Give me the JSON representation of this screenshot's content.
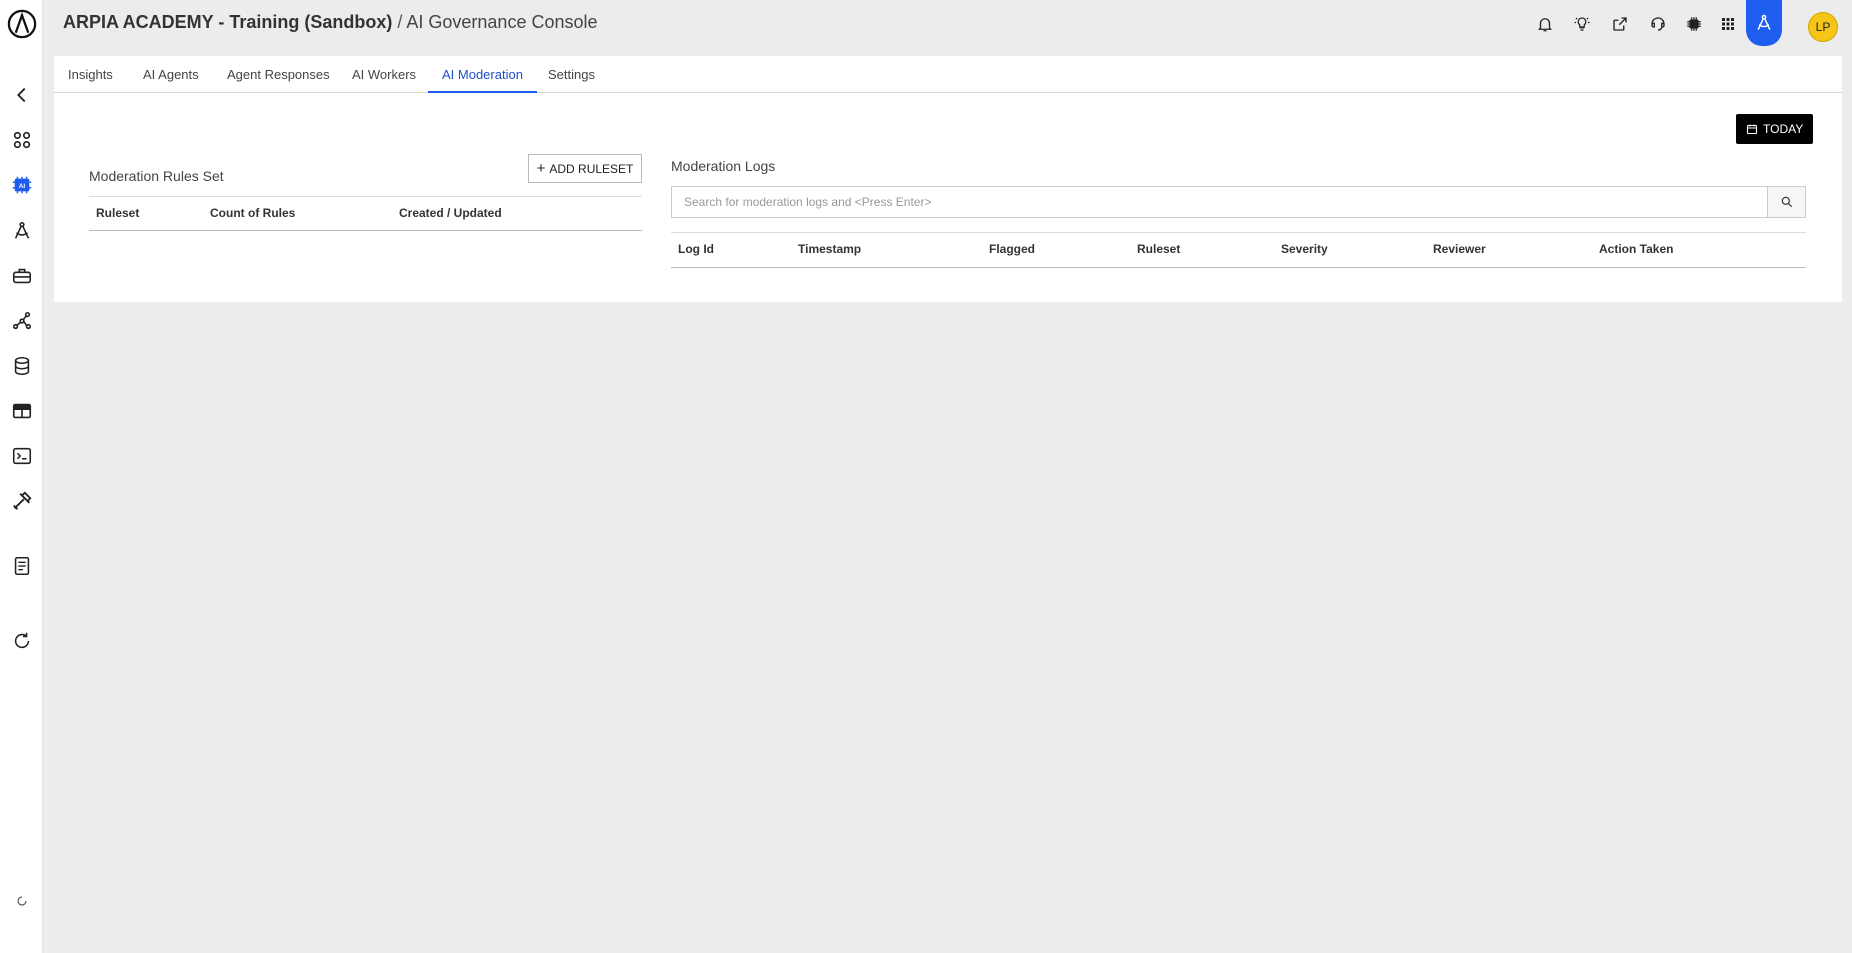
{
  "header": {
    "org_title": "ARPIA ACADEMY - Training (Sandbox)",
    "separator": "/",
    "page_title": "AI Governance Console",
    "avatar_initials": "LP",
    "accent_color": "#1f5cf0"
  },
  "sidebar": {
    "items": [
      {
        "icon": "arpia-logo-icon"
      },
      {
        "icon": "back-arrow-icon"
      },
      {
        "icon": "apps-grid-icon"
      },
      {
        "icon": "ai-chip-icon"
      },
      {
        "icon": "compass-draw-icon"
      },
      {
        "icon": "toolbox-icon"
      },
      {
        "icon": "graph-nodes-icon"
      },
      {
        "icon": "database-icon"
      },
      {
        "icon": "table-icon"
      },
      {
        "icon": "terminal-icon"
      },
      {
        "icon": "tools-icon"
      },
      {
        "icon": "notebook-icon"
      },
      {
        "icon": "refresh-icon"
      },
      {
        "icon": "loading-spinner-icon"
      }
    ]
  },
  "topbar_icons": [
    "bell-icon",
    "lightbulb-icon",
    "share-icon",
    "support-headset-icon",
    "chip-icon",
    "apps-grid-icon",
    "compass-app-icon"
  ],
  "tabs": [
    {
      "label": "Insights",
      "active": false
    },
    {
      "label": "AI Agents",
      "active": false
    },
    {
      "label": "Agent Responses",
      "active": false
    },
    {
      "label": "AI Workers",
      "active": false
    },
    {
      "label": "AI Moderation",
      "active": true
    },
    {
      "label": "Settings",
      "active": false
    }
  ],
  "date_filter": {
    "label": "TODAY"
  },
  "rules": {
    "title": "Moderation Rules Set",
    "add_button": "ADD RULESET",
    "columns": [
      "Ruleset",
      "Count of Rules",
      "Created / Updated"
    ],
    "rows": []
  },
  "logs": {
    "title": "Moderation Logs",
    "search_placeholder": "Search for moderation logs and <Press Enter>",
    "search_value": "",
    "columns": [
      "Log Id",
      "Timestamp",
      "Flagged",
      "Ruleset",
      "Severity",
      "Reviewer",
      "Action Taken"
    ],
    "rows": []
  }
}
